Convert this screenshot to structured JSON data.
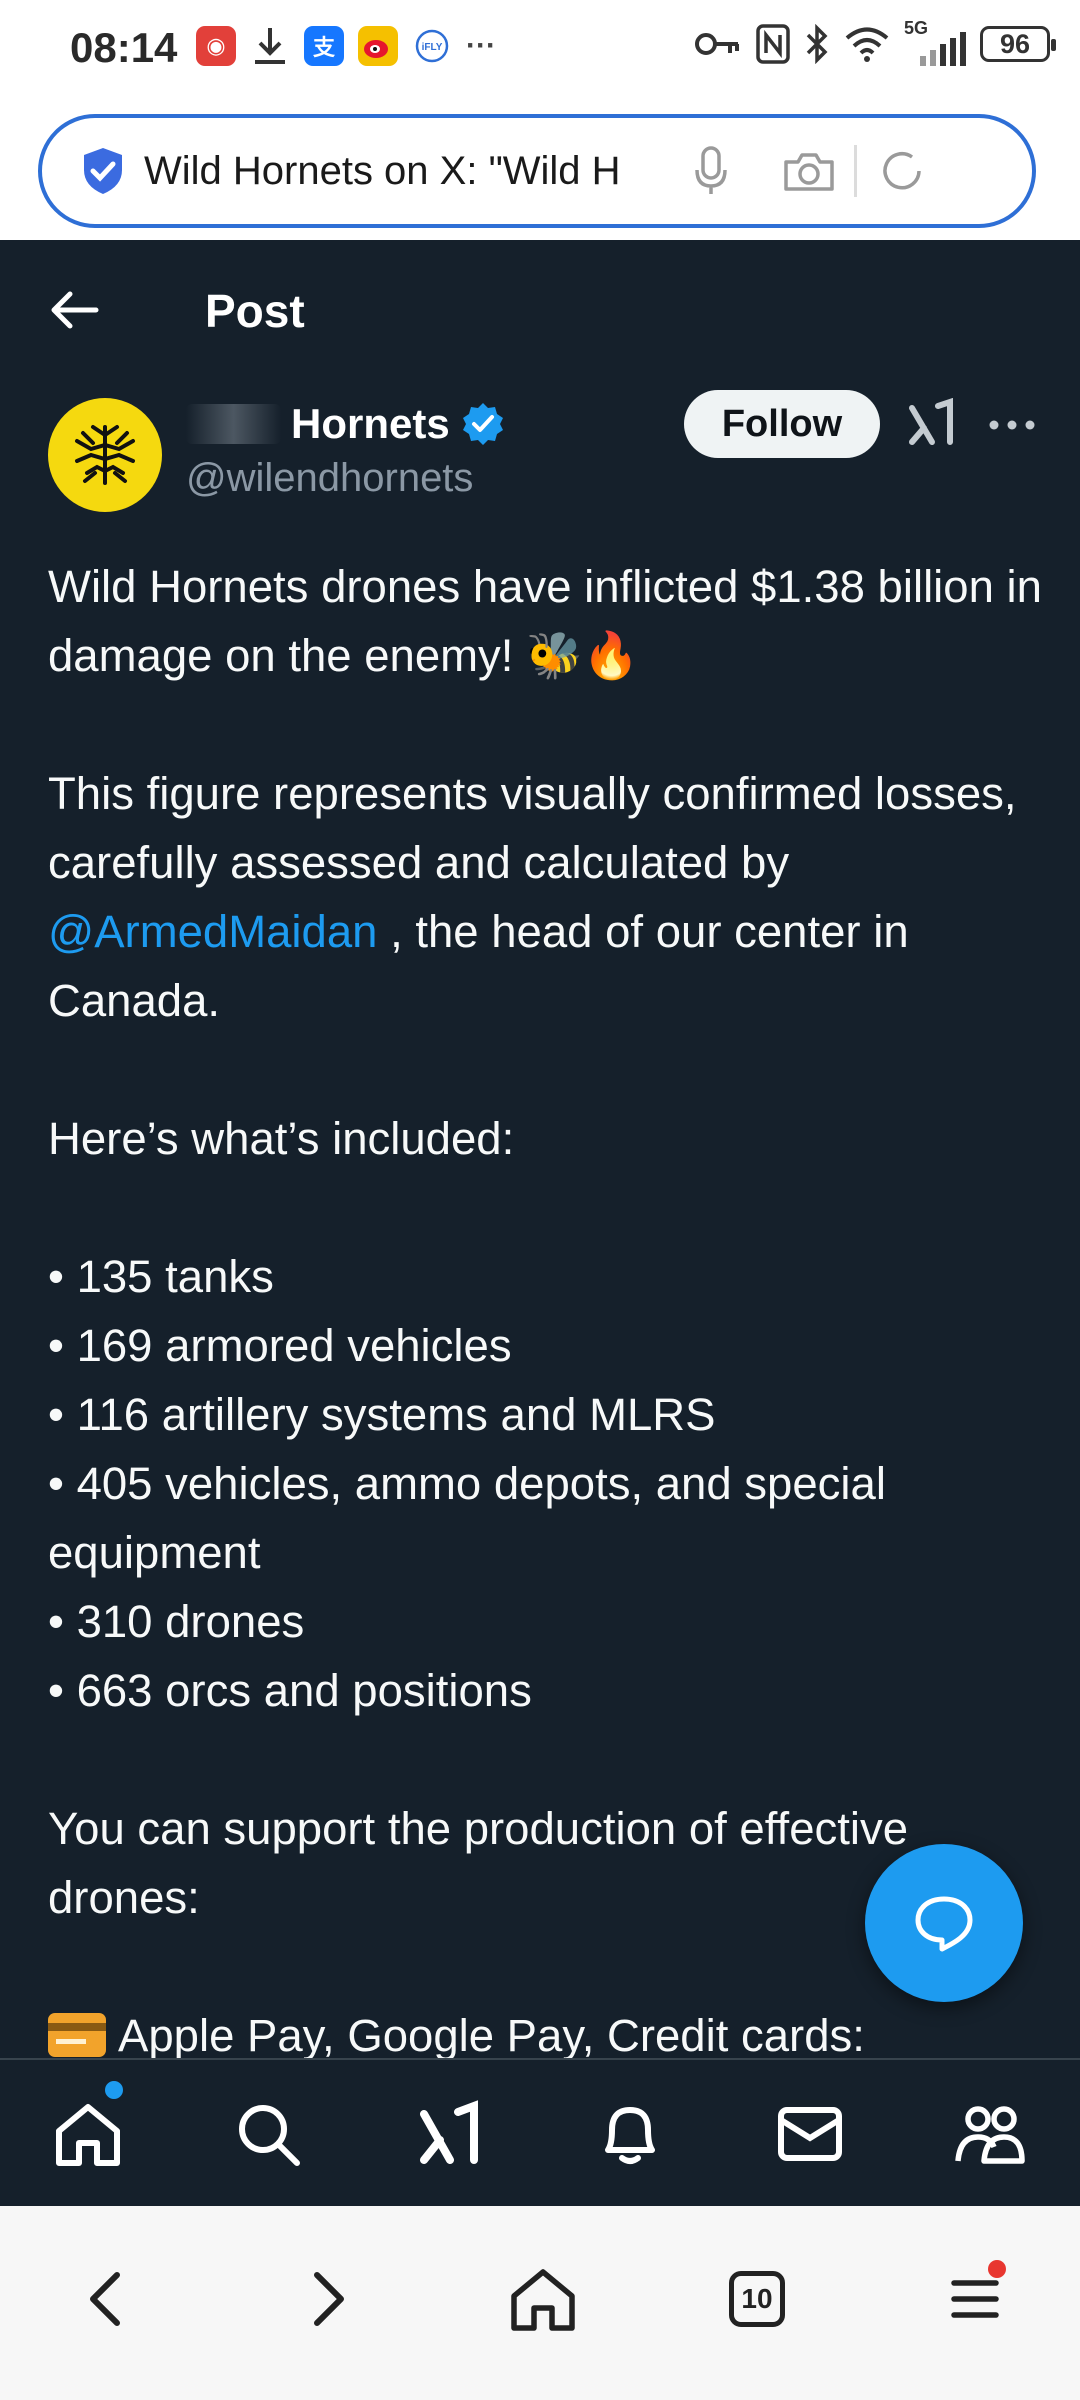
{
  "status_bar": {
    "time": "08:14",
    "network": "5G",
    "battery": "96",
    "more": "···"
  },
  "browser": {
    "url_text": "Wild Hornets on X: \"Wild H",
    "tabs_count": "10"
  },
  "header": {
    "title": "Post"
  },
  "author": {
    "name": "Hornets",
    "handle": "@wilendhornets",
    "follow_label": "Follow",
    "avatar_color": "#f5d90f"
  },
  "post": {
    "line1": "Wild Hornets drones have inflicted $1.38 billion in damage on the enemy! 🐝🔥",
    "line2_pre": "This figure represents visually confirmed losses, carefully assessed and calculated by ",
    "mention": "@ArmedMaidan",
    "line2_post": " , the head of our center in Canada.",
    "included_heading": "Here’s what’s included:",
    "items": [
      "• 135 tanks",
      "• 169 armored vehicles",
      "• 116 artillery systems and MLRS",
      "• 405 vehicles, ammo depots, and special equipment",
      "• 310 drones",
      "• 663 orcs and positions"
    ],
    "support_line": "You can support the production of effective drones:",
    "payment_line": "Apple Pay, Google Pay, Credit cards:"
  },
  "colors": {
    "background": "#15202b",
    "accent": "#1d9bf0",
    "url_border": "#2e6fd6"
  }
}
